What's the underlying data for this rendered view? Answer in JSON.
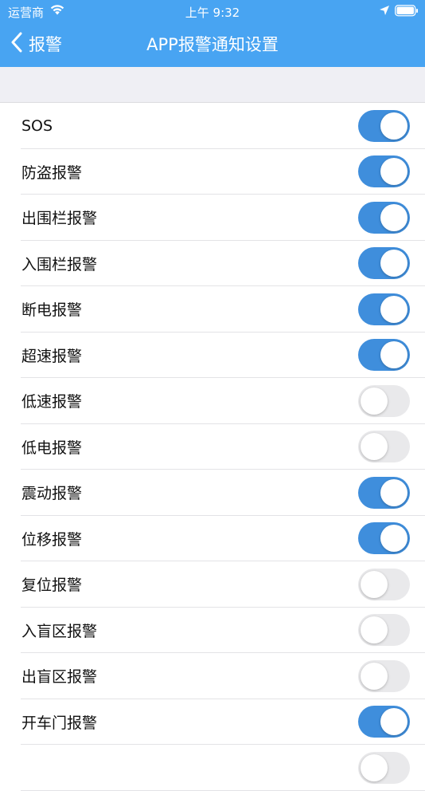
{
  "status_bar": {
    "carrier": "运营商",
    "time": "上午 9:32"
  },
  "nav": {
    "back_label": "报警",
    "title": "APP报警通知设置"
  },
  "alarms": [
    {
      "label": "SOS",
      "enabled": true
    },
    {
      "label": "防盗报警",
      "enabled": true
    },
    {
      "label": "出围栏报警",
      "enabled": true
    },
    {
      "label": "入围栏报警",
      "enabled": true
    },
    {
      "label": "断电报警",
      "enabled": true
    },
    {
      "label": "超速报警",
      "enabled": true
    },
    {
      "label": "低速报警",
      "enabled": false
    },
    {
      "label": "低电报警",
      "enabled": false
    },
    {
      "label": "震动报警",
      "enabled": true
    },
    {
      "label": "位移报警",
      "enabled": true
    },
    {
      "label": "复位报警",
      "enabled": false
    },
    {
      "label": "入盲区报警",
      "enabled": false
    },
    {
      "label": "出盲区报警",
      "enabled": false
    },
    {
      "label": "开车门报警",
      "enabled": true
    },
    {
      "label": "",
      "enabled": false
    }
  ],
  "colors": {
    "header": "#48a4f2",
    "toggle_on": "#3f8edc",
    "toggle_off": "#e9e9eb"
  }
}
